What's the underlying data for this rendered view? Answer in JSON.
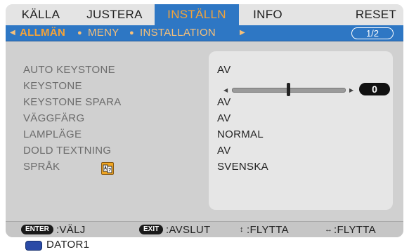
{
  "tabs": [
    {
      "label": "KÄLLA",
      "active": false
    },
    {
      "label": "JUSTERA",
      "active": false
    },
    {
      "label": "INSTÄLLN",
      "active": true
    },
    {
      "label": "INFO",
      "active": false
    },
    {
      "label": "RESET",
      "active": false
    }
  ],
  "subtabs": [
    {
      "label": "ALLMÄN",
      "active": true
    },
    {
      "label": "MENY",
      "active": false
    },
    {
      "label": "INSTALLATION",
      "active": false
    }
  ],
  "page_indicator": "1/2",
  "settings": [
    {
      "label": "AUTO KEYSTONE",
      "value": "AV"
    },
    {
      "label": "KEYSTONE",
      "value": ""
    },
    {
      "label": "KEYSTONE SPARA",
      "value": "AV"
    },
    {
      "label": "VÄGGFÄRG",
      "value": "AV"
    },
    {
      "label": "LAMPLÄGE",
      "value": "NORMAL"
    },
    {
      "label": "DOLD TEXTNING",
      "value": "AV"
    },
    {
      "label": "SPRÅK",
      "value": "SVENSKA"
    }
  ],
  "keystone_slider": {
    "value": "0",
    "position_fraction": 0.5
  },
  "footer": {
    "enter_key": "ENTER",
    "enter_text": ":VÄLJ",
    "exit_key": "EXIT",
    "exit_text": ":AVSLUT",
    "updown_text": ":FLYTTA",
    "leftright_text": ":FLYTTA"
  },
  "source": {
    "label": "DATOR1"
  },
  "colors": {
    "accent": "#2e77c4",
    "highlight": "#f5a338"
  }
}
